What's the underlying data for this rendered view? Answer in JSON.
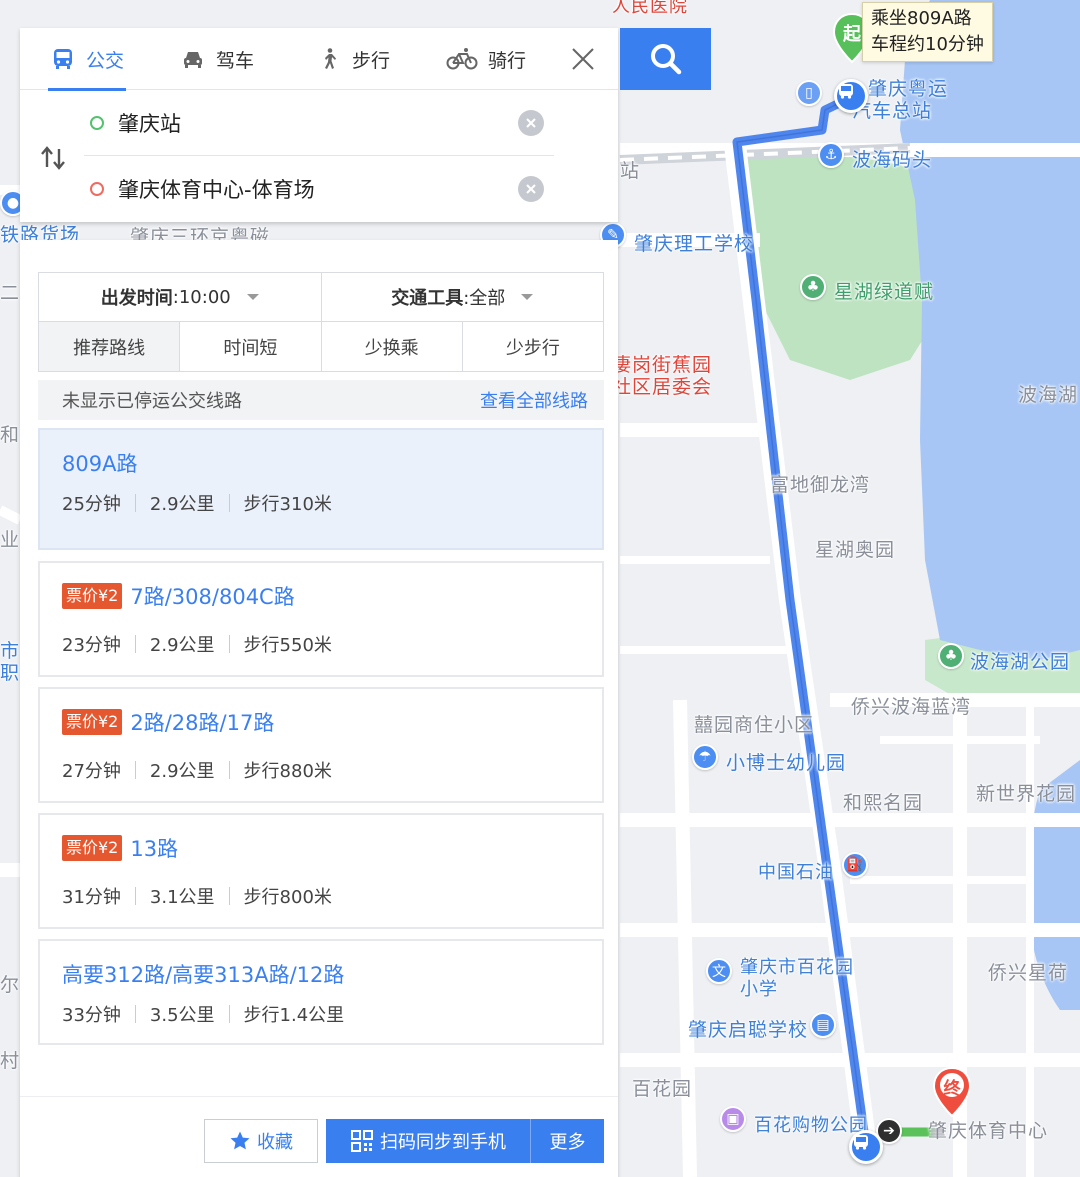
{
  "colors": {
    "accent": "#3a7ff0",
    "fare_badge": "#e5582f",
    "start_dot": "#53c26e",
    "end_dot": "#ef6b5f",
    "route_line": "#4f86ee",
    "lake": "#a7c6f5",
    "park": "#bde3c1"
  },
  "mode_tabs": [
    {
      "label": "公交",
      "icon": "bus-icon",
      "active": true
    },
    {
      "label": "驾车",
      "icon": "car-icon",
      "active": false
    },
    {
      "label": "步行",
      "icon": "walk-icon",
      "active": false
    },
    {
      "label": "骑行",
      "icon": "bike-icon",
      "active": false
    }
  ],
  "route_input": {
    "start": "肇庆站",
    "end": "肇庆体育中心-体育场"
  },
  "filters": {
    "depart_label": "出发时间",
    "depart_value": ":10:00",
    "transport_label": "交通工具",
    "transport_value": ":全部"
  },
  "sort_tabs": [
    "推荐路线",
    "时间短",
    "少换乘",
    "少步行"
  ],
  "notice": {
    "text": "未显示已停运公交线路",
    "link": "查看全部线路"
  },
  "routes": [
    {
      "fare": "",
      "name": "809A路",
      "duration": "25分钟",
      "distance": "2.9公里",
      "walk": "步行310米",
      "selected": true
    },
    {
      "fare": "票价¥2",
      "name": "7路/308/804C路",
      "duration": "23分钟",
      "distance": "2.9公里",
      "walk": "步行550米",
      "selected": false
    },
    {
      "fare": "票价¥2",
      "name": "2路/28路/17路",
      "duration": "27分钟",
      "distance": "2.9公里",
      "walk": "步行880米",
      "selected": false
    },
    {
      "fare": "票价¥2",
      "name": "13路",
      "duration": "31分钟",
      "distance": "3.1公里",
      "walk": "步行800米",
      "selected": false
    },
    {
      "fare": "",
      "name": "高要312路/高要313A路/12路",
      "duration": "33分钟",
      "distance": "3.5公里",
      "walk": "步行1.4公里",
      "selected": false
    }
  ],
  "actions": {
    "favorite": "收藏",
    "sync": "扫码同步到手机",
    "more": "更多"
  },
  "map": {
    "tooltip_line1": "乘坐809A路",
    "tooltip_line2": "车程约10分钟",
    "start_pin": "起",
    "end_pin": "终",
    "labels": {
      "hospital": "人民医院",
      "bus_station_1": "肇庆粤运",
      "bus_station_2": "汽车总站",
      "bohai_pier": "波海码头",
      "rail_station_frag": "站",
      "rail_yard_frag": "铁路货场",
      "ring_road_frag": "肇庆三环京粤磁",
      "polytech": "肇庆理工学校",
      "xinghu_green": "星湖绿道赋",
      "fenggang_1": "凄岗街蕉园",
      "fenggang_2": "社区居委会",
      "bohai_lake": "波海湖",
      "fudi": "富地御龙湾",
      "xinghu_ao": "星湖奥园",
      "bohai_park": "波海湖公园",
      "qiaoxing_lanwan": "侨兴波海蓝湾",
      "xiyuan": "囍园商住小区",
      "kindergarten": "小博士幼儿园",
      "hexi": "和熙名园",
      "xinshijie": "新世界花园",
      "sinopec": "中国石油",
      "baihua_school_1": "肇庆市百花园",
      "baihua_school_2": "小学",
      "qixing": "侨兴星荷",
      "qicong": "肇庆启聪学校",
      "baihuayuan": "百花园",
      "baihua_mall": "百花购物公园",
      "sports_center": "肇庆体育中心",
      "left_frag_1": "二",
      "left_frag_2": "和",
      "left_frag_3": "业",
      "left_frag_4": "市",
      "left_frag_5": "职",
      "left_frag_6": "尔",
      "left_frag_7": "村"
    }
  }
}
